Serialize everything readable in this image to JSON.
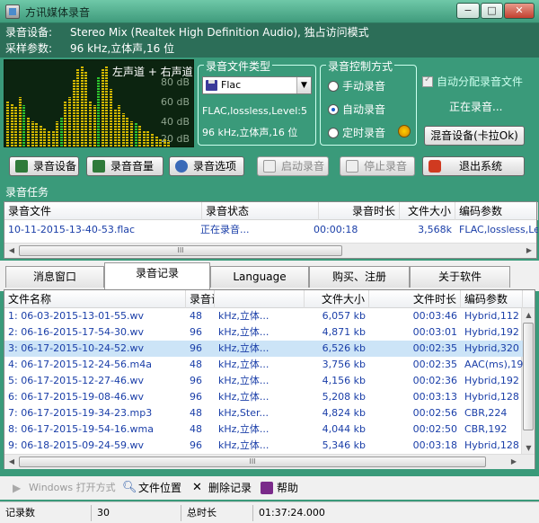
{
  "window": {
    "title": "方讯媒体录音",
    "min_label": "−",
    "max_label": "□",
    "close_label": "✕"
  },
  "info": {
    "device_label": "录音设备:",
    "device_value": "Stereo Mix (Realtek High Definition Audio), 独占访问模式",
    "params_label": "采样参数:",
    "params_value": "96    kHz,立体声,16  位"
  },
  "meter": {
    "caption": "左声道 + 右声道",
    "db_labels": [
      "80 dB",
      "60 dB",
      "40 dB",
      "20 dB"
    ],
    "levels": [
      0.55,
      0.52,
      0.48,
      0.6,
      0.5,
      0.35,
      0.3,
      0.28,
      0.25,
      0.22,
      0.2,
      0.18,
      0.3,
      0.35,
      0.55,
      0.6,
      0.8,
      0.95,
      0.98,
      0.9,
      0.55,
      0.5,
      0.85,
      0.95,
      0.98,
      0.7,
      0.45,
      0.5,
      0.4,
      0.35,
      0.3,
      0.28,
      0.25,
      0.2,
      0.18,
      0.15,
      0.12,
      0.1,
      0.1,
      0.08
    ]
  },
  "format_group": {
    "legend": "录音文件类型",
    "selected": "Flac",
    "line1": "FLAC,lossless,Level:5",
    "line2": "96    kHz,立体声,16  位"
  },
  "control_group": {
    "legend": "录音控制方式",
    "options": [
      "手动录音",
      "自动录音",
      "定时录音"
    ],
    "selected_index": 1
  },
  "right_panel": {
    "auto_assign": "自动分配录音文件",
    "status": "正在录音...",
    "mixer_button": "混音设备(卡拉Ok)"
  },
  "toolbar": {
    "device": "录音设备",
    "volume": "录音音量",
    "options": "录音选项",
    "start": "启动录音",
    "stop": "停止录音",
    "exit": "退出系统"
  },
  "task": {
    "label": "录音任务",
    "columns": [
      "录音文件",
      "录音状态",
      "录音时长",
      "文件大小",
      "编码参数"
    ],
    "row": [
      "10-11-2015-13-40-53.flac",
      "正在录音...",
      "00:00:18",
      "3,568k",
      "FLAC,lossless,Lev"
    ],
    "scroll_mark": "III"
  },
  "tabs": [
    "消息窗口",
    "录音记录",
    "Language",
    "购买、注册",
    "关于软件"
  ],
  "active_tab": 1,
  "records": {
    "columns": [
      "文件名称",
      "录音设备采样参数",
      "",
      "文件大小",
      "文件时长",
      "编码参数"
    ],
    "rows": [
      [
        "1: 06-03-2015-13-01-55.wv",
        "48",
        "kHz,立体...",
        "6,057 kb",
        "00:03:46",
        "Hybrid,112"
      ],
      [
        "2: 06-16-2015-17-54-30.wv",
        "96",
        "kHz,立体...",
        "4,871 kb",
        "00:03:01",
        "Hybrid,192"
      ],
      [
        "3: 06-17-2015-10-24-52.wv",
        "96",
        "kHz,立体...",
        "6,526 kb",
        "00:02:35",
        "Hybrid,320"
      ],
      [
        "4: 06-17-2015-12-24-56.m4a",
        "48",
        "kHz,立体...",
        "3,756 kb",
        "00:02:35",
        "AAC(ms),19"
      ],
      [
        "5: 06-17-2015-12-27-46.wv",
        "96",
        "kHz,立体...",
        "4,156 kb",
        "00:02:36",
        "Hybrid,192"
      ],
      [
        "6: 06-17-2015-19-08-46.wv",
        "96",
        "kHz,立体...",
        "5,208 kb",
        "00:03:13",
        "Hybrid,128"
      ],
      [
        "7: 06-17-2015-19-34-23.mp3",
        "48",
        "kHz,Ster...",
        "4,824 kb",
        "00:02:56",
        "CBR,224"
      ],
      [
        "8: 06-17-2015-19-54-16.wma",
        "48",
        "kHz,立体...",
        "4,044 kb",
        "00:02:50",
        "CBR,192"
      ],
      [
        "9: 06-18-2015-09-24-59.wv",
        "96",
        "kHz,立体...",
        "5,346 kb",
        "00:03:18",
        "Hybrid,128"
      ]
    ],
    "selected_index": 2,
    "scroll_mark": "III"
  },
  "bottom_tools": {
    "open_with": "Windows 打开方式",
    "location": "文件位置",
    "delete": "删除记录",
    "help": "帮助"
  },
  "status": {
    "count_label": "记录数",
    "count_value": "30",
    "total_label": "总时长",
    "total_value": "01:37:24.000"
  }
}
